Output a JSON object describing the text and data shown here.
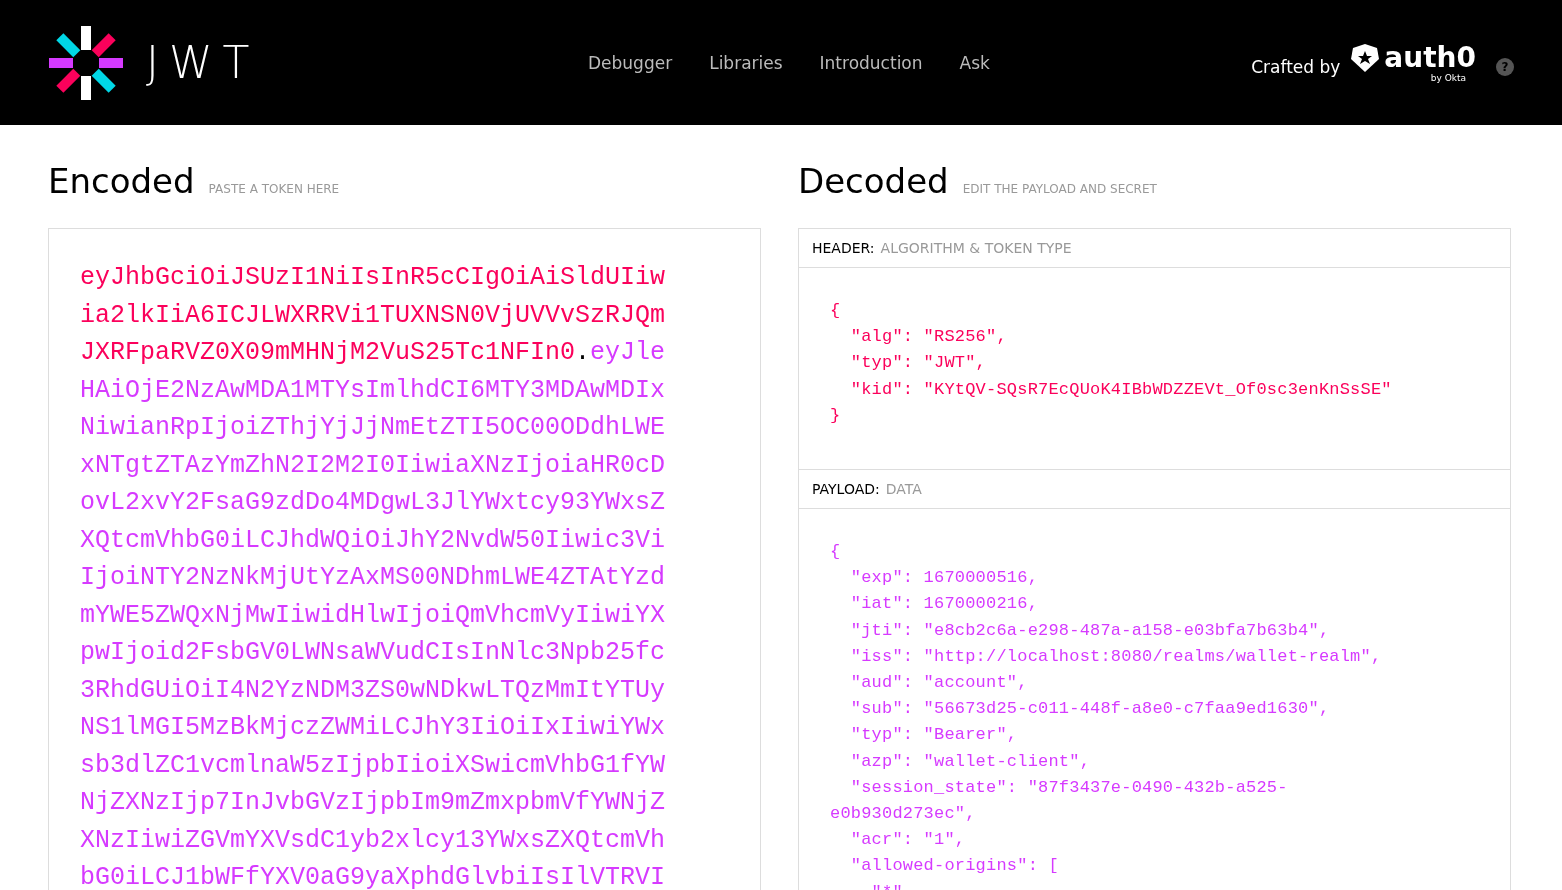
{
  "brand": {
    "logo_text": "JWT"
  },
  "nav": [
    {
      "label": "Debugger"
    },
    {
      "label": "Libraries"
    },
    {
      "label": "Introduction"
    },
    {
      "label": "Ask"
    }
  ],
  "crafted": {
    "label": "Crafted by",
    "brand": "auth0",
    "sub": "by Okta",
    "help": "?"
  },
  "encoded": {
    "title": "Encoded",
    "hint": "PASTE A TOKEN HERE",
    "lines": [
      [
        {
          "kind": "header",
          "text": "eyJhbGciOiJSUzI1NiIsInR5cCIgOiAiSldUIiw"
        }
      ],
      [
        {
          "kind": "header",
          "text": "ia2lkIiA6ICJLWXRRVi1TUXNSN0VjUVVvSzRJQm"
        }
      ],
      [
        {
          "kind": "header",
          "text": "JXRFpaRVZ0X09mMHNjM2VuS25Tc1NFIn0"
        },
        {
          "kind": "dot",
          "text": "."
        },
        {
          "kind": "payload",
          "text": "eyJle"
        }
      ],
      [
        {
          "kind": "payload",
          "text": "HAiOjE2NzAwMDA1MTYsImlhdCI6MTY3MDAwMDIx"
        }
      ],
      [
        {
          "kind": "payload",
          "text": "NiwianRpIjoiZThjYjJjNmEtZTI5OC00ODdhLWE"
        }
      ],
      [
        {
          "kind": "payload",
          "text": "xNTgtZTAzYmZhN2I2M2I0IiwiaXNzIjoiaHR0cD"
        }
      ],
      [
        {
          "kind": "payload",
          "text": "ovL2xvY2FsaG9zdDo4MDgwL3JlYWxtcy93YWxsZ"
        }
      ],
      [
        {
          "kind": "payload",
          "text": "XQtcmVhbG0iLCJhdWQiOiJhY2NvdW50Iiwic3Vi"
        }
      ],
      [
        {
          "kind": "payload",
          "text": "IjoiNTY2NzNkMjUtYzAxMS00NDhmLWE4ZTAtYzd"
        }
      ],
      [
        {
          "kind": "payload",
          "text": "mYWE5ZWQxNjMwIiwidHlwIjoiQmVhcmVyIiwiYX"
        }
      ],
      [
        {
          "kind": "payload",
          "text": "pwIjoid2FsbGV0LWNsaWVudCIsInNlc3Npb25fc"
        }
      ],
      [
        {
          "kind": "payload",
          "text": "3RhdGUiOiI4N2YzNDM3ZS0wNDkwLTQzMmItYTUy"
        }
      ],
      [
        {
          "kind": "payload",
          "text": "NS1lMGI5MzBkMjczZWMiLCJhY3IiOiIxIiwiYWx"
        }
      ],
      [
        {
          "kind": "payload",
          "text": "sb3dlZC1vcmlnaW5zIjpbIioiXSwicmVhbG1fYW"
        }
      ],
      [
        {
          "kind": "payload",
          "text": "NjZXNzIjp7InJvbGVzIjpbIm9mZmxpbmVfYWNjZ"
        }
      ],
      [
        {
          "kind": "payload",
          "text": "XNzIiwiZGVmYXVsdC1yb2xlcy13YWxsZXQtcmVh"
        }
      ],
      [
        {
          "kind": "payload",
          "text": "bG0iLCJ1bWFfYXV0aG9yaXphdGlvbiIsIlVTRVI"
        }
      ]
    ]
  },
  "decoded": {
    "title": "Decoded",
    "hint": "EDIT THE PAYLOAD AND SECRET",
    "sections": [
      {
        "kind": "header",
        "label": "HEADER:",
        "sublabel": "ALGORITHM & TOKEN TYPE",
        "lines": [
          "{",
          "  \"alg\": \"RS256\",",
          "  \"typ\": \"JWT\",",
          "  \"kid\": \"KYtQV-SQsR7EcQUoK4IBbWDZZEVt_Of0sc3enKnSsSE\"",
          "}"
        ]
      },
      {
        "kind": "payload",
        "label": "PAYLOAD:",
        "sublabel": "DATA",
        "lines": [
          "{",
          "  \"exp\": 1670000516,",
          "  \"iat\": 1670000216,",
          "  \"jti\": \"e8cb2c6a-e298-487a-a158-e03bfa7b63b4\",",
          "  \"iss\": \"http://localhost:8080/realms/wallet-realm\",",
          "  \"aud\": \"account\",",
          "  \"sub\": \"56673d25-c011-448f-a8e0-c7faa9ed1630\",",
          "  \"typ\": \"Bearer\",",
          "  \"azp\": \"wallet-client\",",
          "  \"session_state\": \"87f3437e-0490-432b-a525-",
          "e0b930d273ec\",",
          "  \"acr\": \"1\",",
          "  \"allowed-origins\": [",
          "    \"*\""
        ]
      }
    ]
  }
}
